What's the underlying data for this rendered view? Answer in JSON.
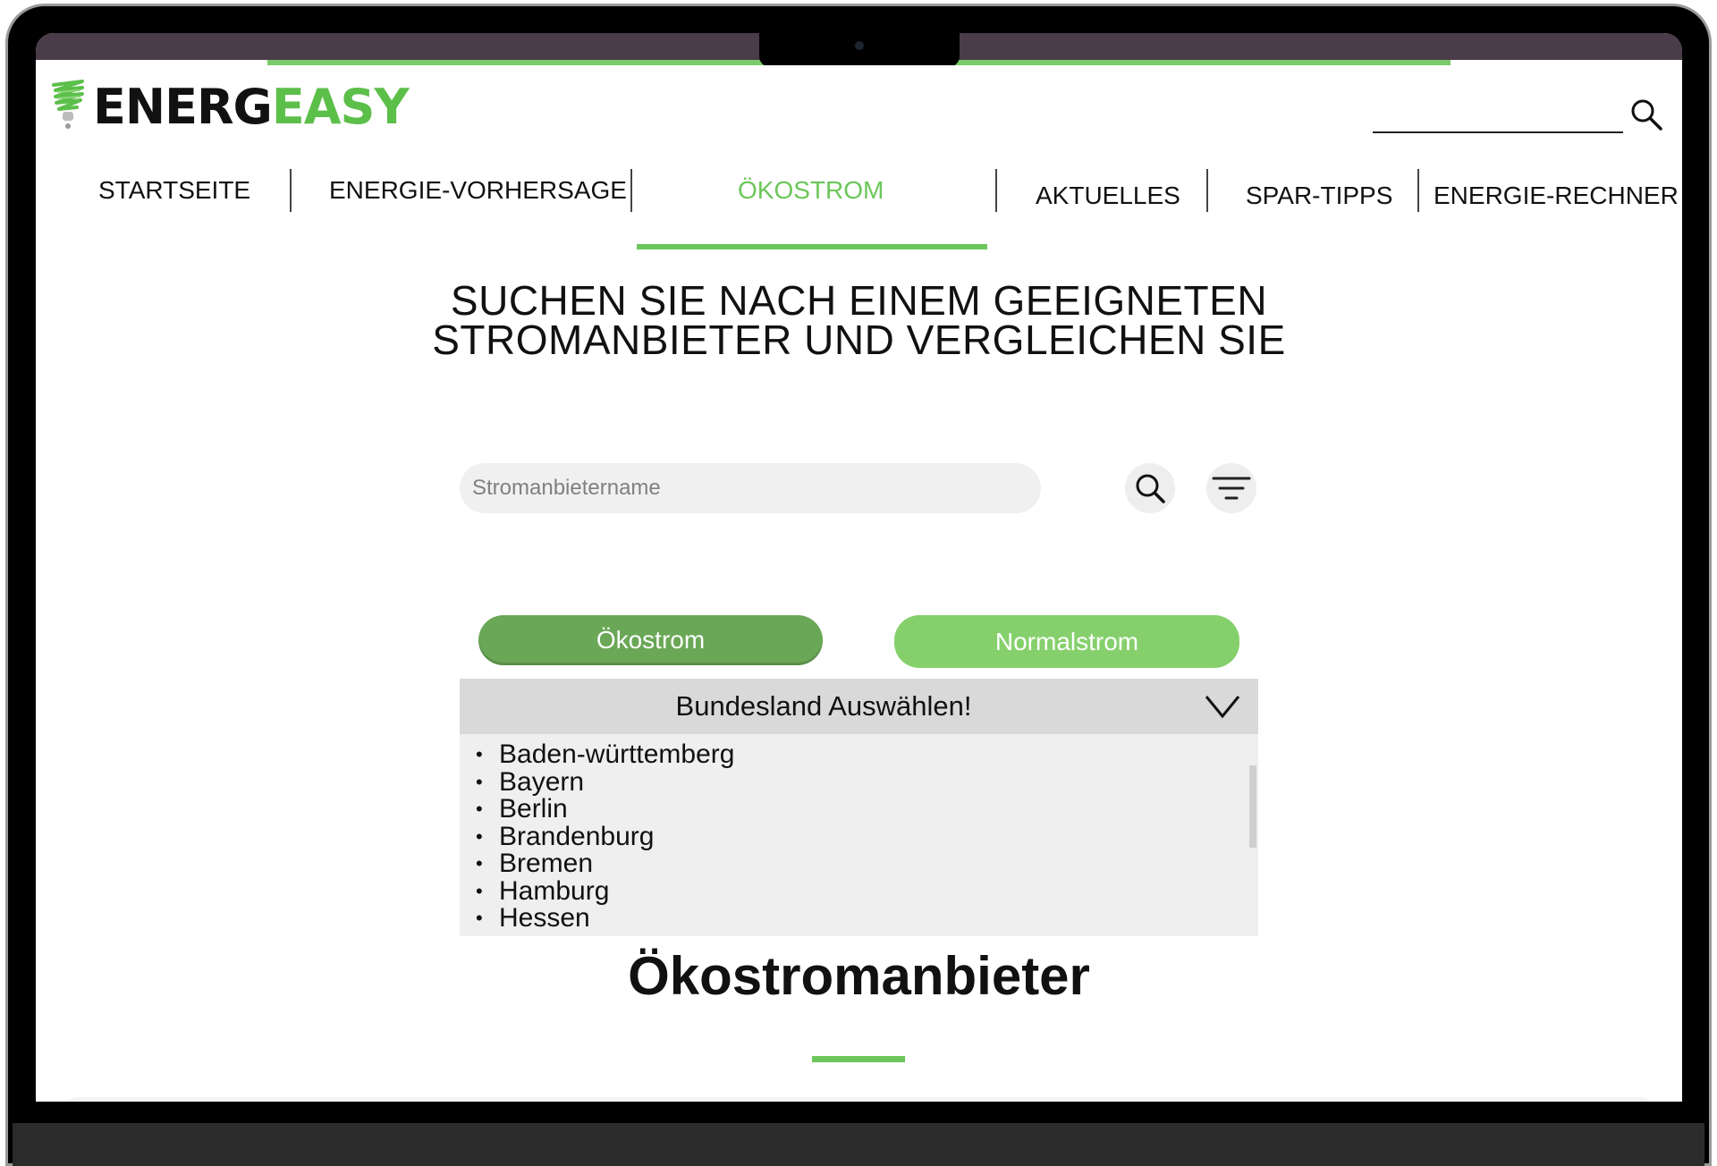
{
  "brand": {
    "part1": "ENERG",
    "part2": "EASY"
  },
  "nav": {
    "items": [
      {
        "label": "STARTSEITE"
      },
      {
        "label": "ENERGIE-VORHERSAGE"
      },
      {
        "label": "ÖKOSTROM"
      },
      {
        "label": "AKTUELLES"
      },
      {
        "label": "SPAR-TIPPS"
      },
      {
        "label": "ENERGIE-RECHNER"
      }
    ],
    "active": "ÖKOSTROM"
  },
  "hero": {
    "line1": "SUCHEN SIE NACH EINEM GEEIGNETEN",
    "line2": "STROMANBIETER UND VERGLEICHEN SIE"
  },
  "search": {
    "placeholder": "Stromanbietername",
    "value": ""
  },
  "icons": {
    "header_search": "search-icon",
    "search": "search-icon",
    "filter": "filter-icon",
    "dropdown": "chevron-down-icon",
    "logo": "energy-bulb-icon"
  },
  "toggles": {
    "oekostrom": "Ökostrom",
    "normalstrom": "Normalstrom"
  },
  "dropdown": {
    "label": "Bundesland Auswählen!",
    "options": [
      "Baden-württemberg",
      "Bayern",
      "Berlin",
      "Brandenburg",
      "Bremen",
      "Hamburg",
      "Hessen"
    ]
  },
  "section": {
    "title": "Ökostromanbieter"
  },
  "colors": {
    "accent": "#6cc65a",
    "oekostrom_button": "#6aa756",
    "normalstrom_button": "#85d06c",
    "dropdown_header": "#d9d9d9",
    "frame_topbar": "#4a3c48"
  }
}
